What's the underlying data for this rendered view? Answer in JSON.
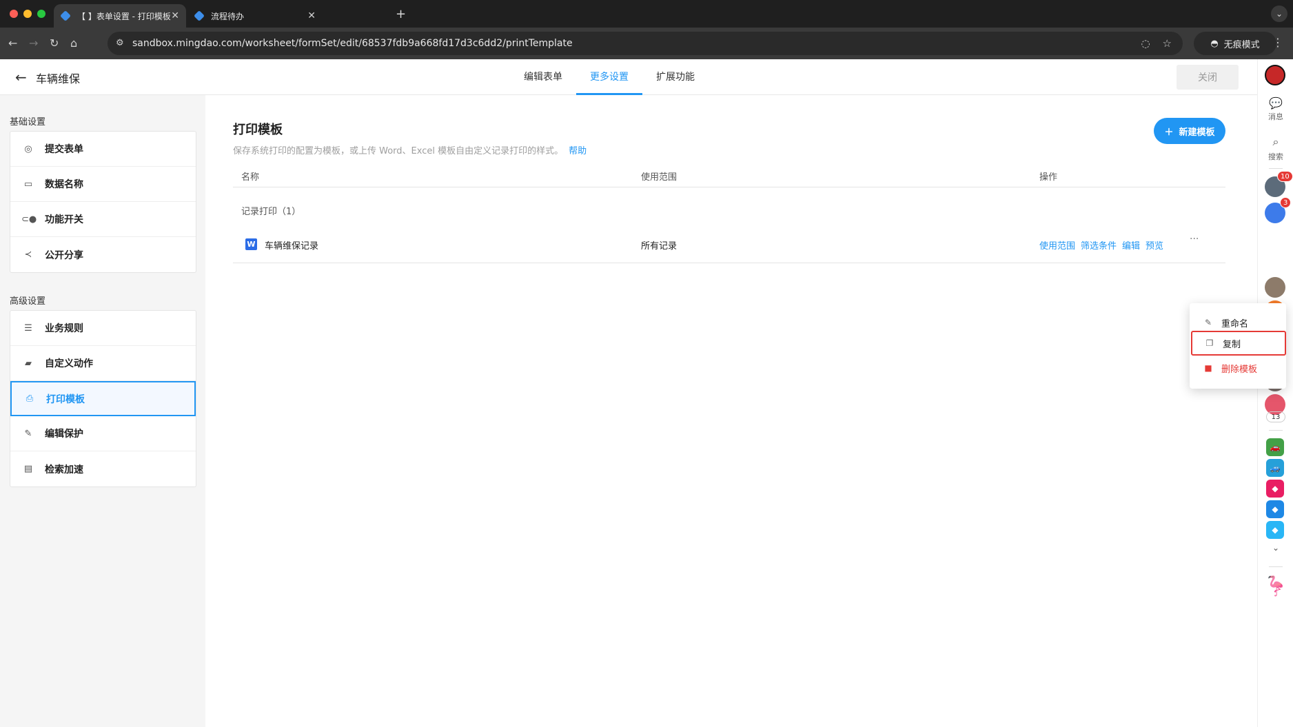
{
  "browser": {
    "tabs": [
      {
        "title": "【         】表单设置 - 打印模板",
        "active": true
      },
      {
        "title": "流程待办",
        "active": false
      }
    ],
    "url": "sandbox.mingdao.com/worksheet/formSet/edit/68537fdb9a668fd17d3c6dd2/printTemplate",
    "incognito_label": "无痕模式"
  },
  "header": {
    "title": "车辆维保",
    "tabs": [
      "编辑表单",
      "更多设置",
      "扩展功能"
    ],
    "active_tab": "更多设置",
    "close_label": "关闭"
  },
  "sidebar": {
    "basic_title": "基础设置",
    "basic_items": [
      {
        "label": "提交表单",
        "icon": "check-circle-icon"
      },
      {
        "label": "数据名称",
        "icon": "title-icon"
      },
      {
        "label": "功能开关",
        "icon": "toggle-icon"
      },
      {
        "label": "公开分享",
        "icon": "share-icon"
      }
    ],
    "advanced_title": "高级设置",
    "advanced_items": [
      {
        "label": "业务规则",
        "icon": "list-icon"
      },
      {
        "label": "自定义动作",
        "icon": "custom-action-icon"
      },
      {
        "label": "打印模板",
        "icon": "printer-icon",
        "active": true
      },
      {
        "label": "编辑保护",
        "icon": "edit-lock-icon"
      },
      {
        "label": "检索加速",
        "icon": "search-speed-icon"
      }
    ]
  },
  "main": {
    "title": "打印模板",
    "description": "保存系统打印的配置为模板，或上传 Word、Excel 模板自由定义记录打印的样式。",
    "help": "帮助",
    "new_button": "新建模板",
    "columns": [
      "名称",
      "使用范围",
      "操作"
    ],
    "group_label": "记录打印（1）",
    "rows": [
      {
        "name": "车辆维保记录",
        "scope": "所有记录",
        "ops": [
          "使用范围",
          "筛选条件",
          "编辑",
          "预览"
        ]
      }
    ],
    "more_glyph": "···"
  },
  "context_menu": {
    "items": [
      {
        "label": "重命名",
        "icon": "pencil-icon"
      },
      {
        "label": "复制",
        "icon": "copy-icon",
        "highlighted": true
      },
      {
        "label": "删除模板",
        "icon": "trash-icon",
        "danger": true
      }
    ]
  },
  "rail": {
    "messages_label": "消息",
    "search_label": "搜索",
    "badge_bell": "10",
    "badge_flash": "3",
    "calendar_count": "13"
  }
}
